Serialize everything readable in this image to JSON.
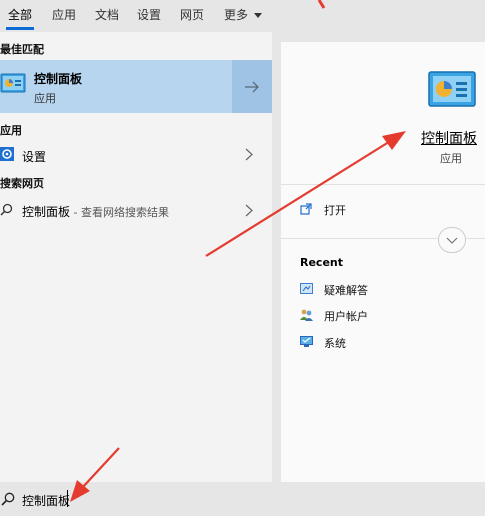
{
  "tabs": [
    {
      "label": "全部"
    },
    {
      "label": "应用"
    },
    {
      "label": "文档"
    },
    {
      "label": "设置"
    },
    {
      "label": "网页"
    },
    {
      "label": "更多"
    }
  ],
  "left": {
    "best_match_title": "最佳匹配",
    "best_match": {
      "title": "控制面板",
      "subtitle": "应用"
    },
    "apps_title": "应用",
    "apps": [
      {
        "label": "设置"
      }
    ],
    "web_title": "搜索网页",
    "web": [
      {
        "label": "控制面板",
        "suffix": " - 查看网络搜索结果"
      }
    ]
  },
  "right": {
    "app_title": "控制面板",
    "app_subtitle": "应用",
    "open_label": "打开",
    "recent_title": "Recent",
    "recent": [
      {
        "label": "疑难解答",
        "icon": "troubleshoot-icon"
      },
      {
        "label": "用户帐户",
        "icon": "user-accounts-icon"
      },
      {
        "label": "系统",
        "icon": "system-icon"
      }
    ]
  },
  "search": {
    "value": "控制面板"
  },
  "colors": {
    "accent": "#0b6bd6",
    "selected": "#b7d5ef",
    "annotation": "#e53b2f"
  }
}
